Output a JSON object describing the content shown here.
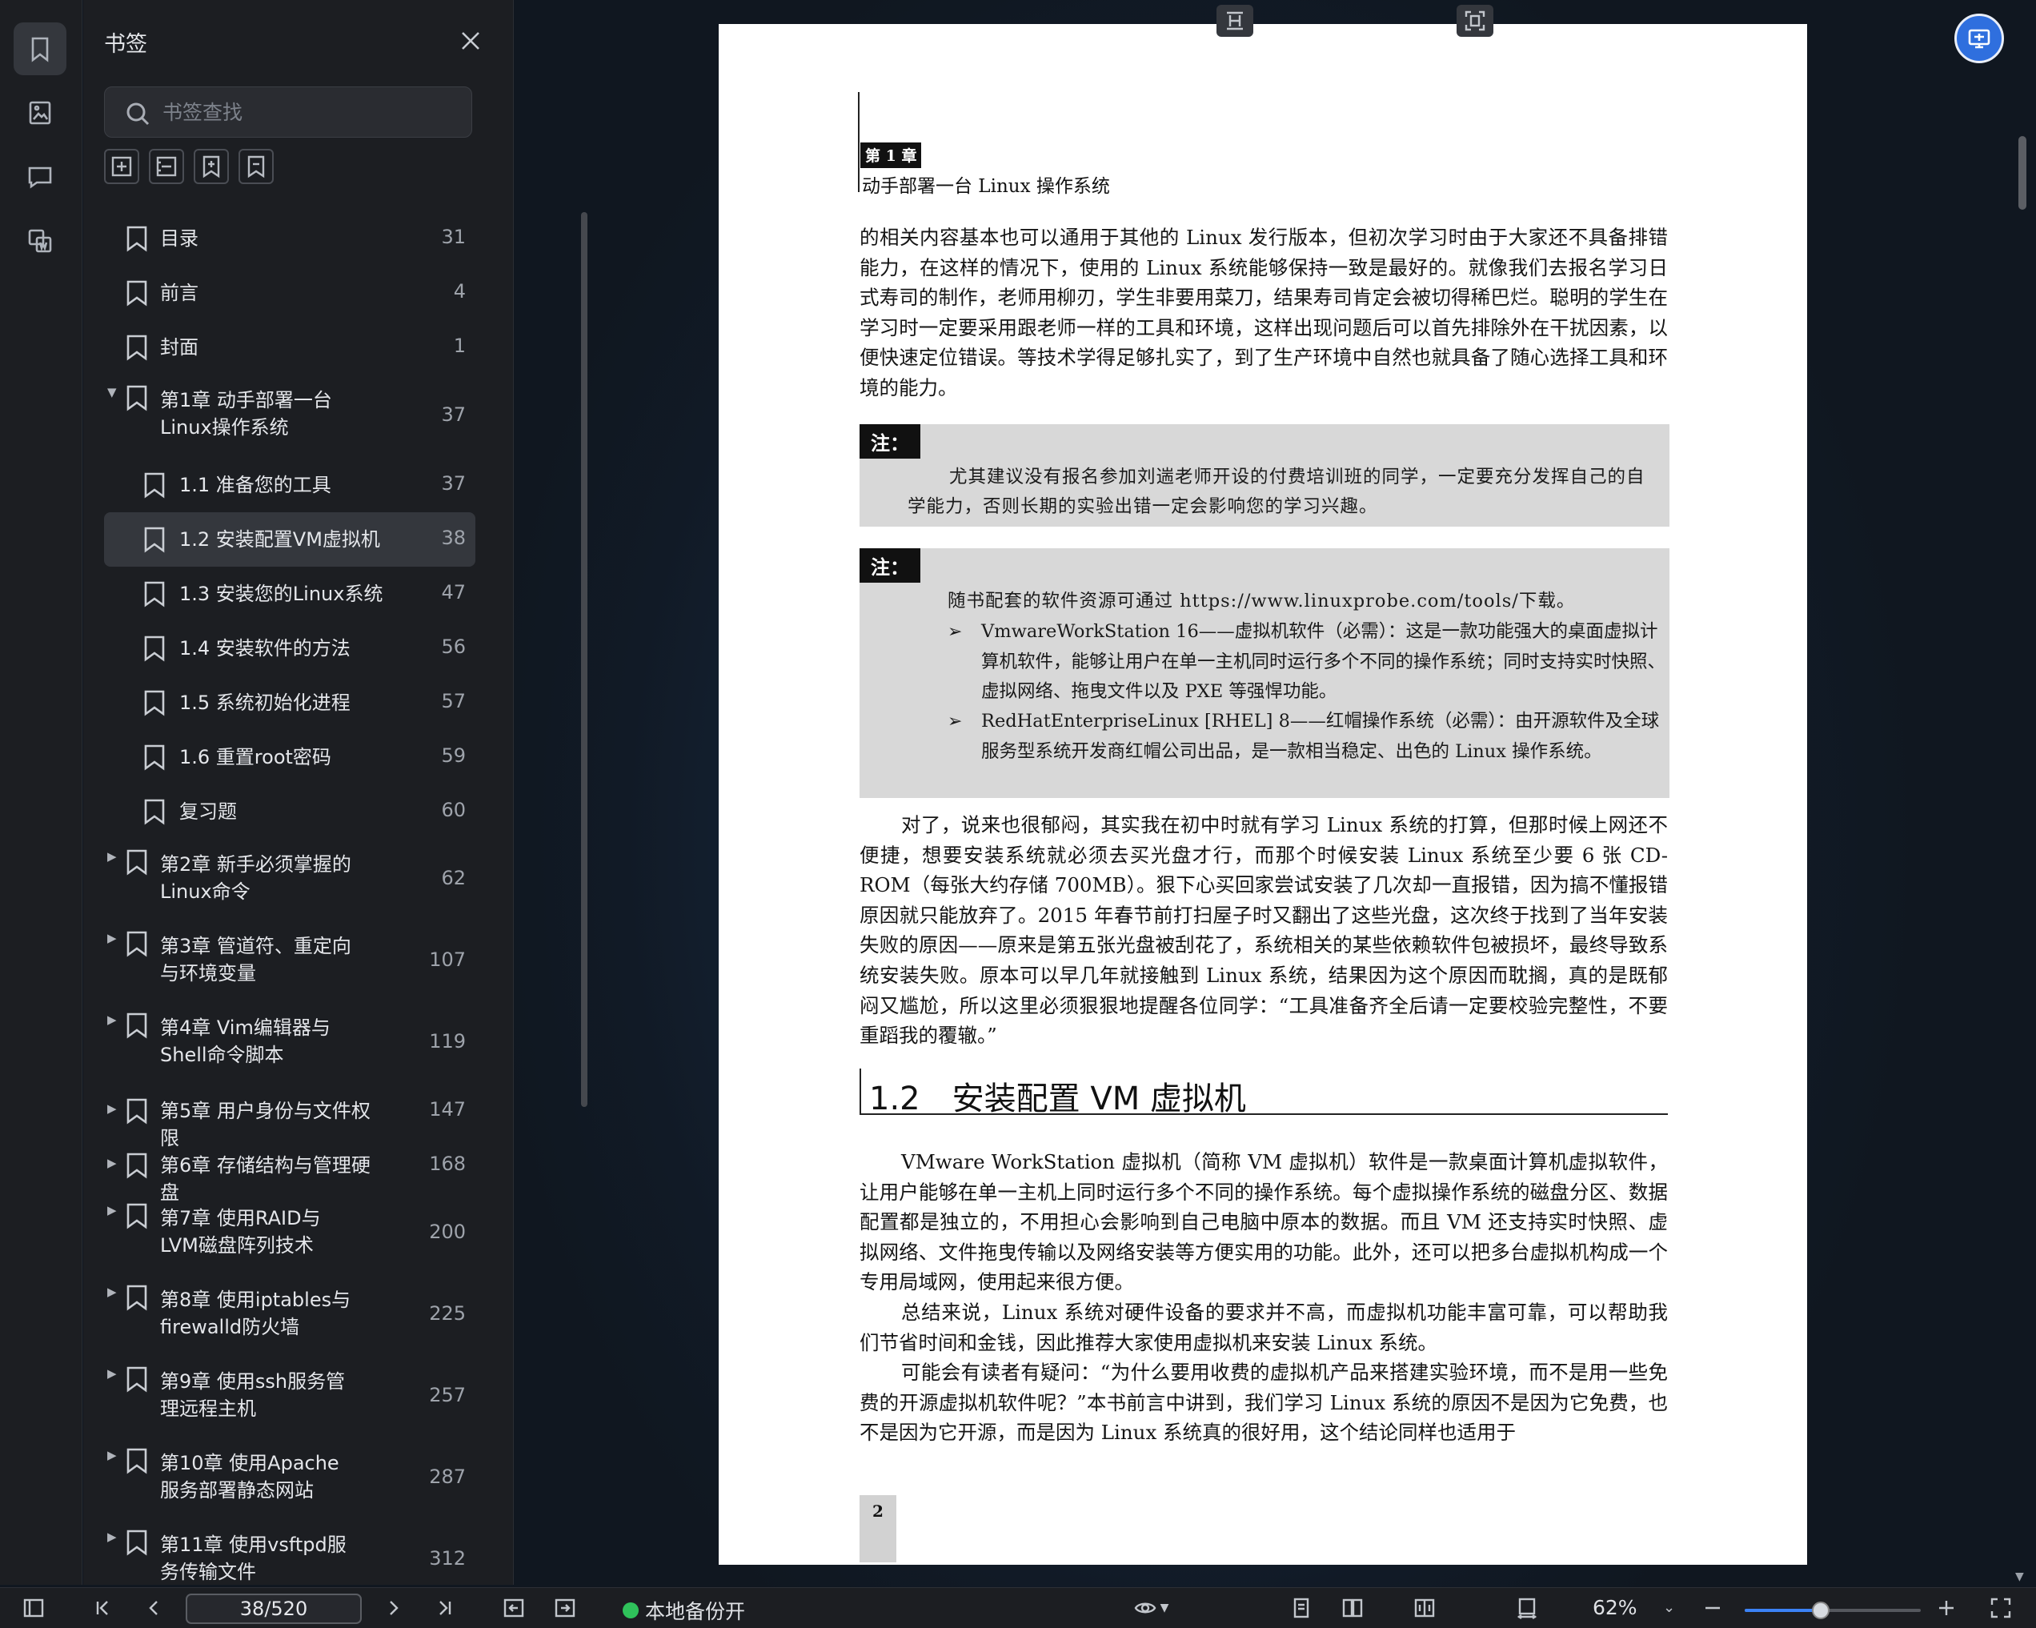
{
  "panel": {
    "title": "书签",
    "search_placeholder": "书签查找"
  },
  "bookmarks": [
    {
      "label": "目录",
      "page": "31"
    },
    {
      "label": "前言",
      "page": "4"
    },
    {
      "label": "封面",
      "page": "1"
    },
    {
      "label": "第1章 动手部署一台Linux操作系统",
      "page": "37",
      "expanded": true
    },
    {
      "label": "1.1 准备您的工具",
      "page": "37"
    },
    {
      "label": "1.2 安装配置VM虚拟机",
      "page": "38",
      "selected": true
    },
    {
      "label": "1.3 安装您的Linux系统",
      "page": "47"
    },
    {
      "label": "1.4 安装软件的方法",
      "page": "56"
    },
    {
      "label": "1.5 系统初始化进程",
      "page": "57"
    },
    {
      "label": "1.6 重置root密码",
      "page": "59"
    },
    {
      "label": "复习题",
      "page": "60"
    },
    {
      "label": "第2章 新手必须掌握的Linux命令",
      "page": "62"
    },
    {
      "label": "第3章 管道符、重定向与环境变量",
      "page": "107"
    },
    {
      "label": "第4章 Vim编辑器与Shell命令脚本",
      "page": "119"
    },
    {
      "label": "第5章 用户身份与文件权限",
      "page": "147"
    },
    {
      "label": "第6章 存储结构与管理硬盘",
      "page": "168"
    },
    {
      "label": "第7章 使用RAID与LVM磁盘阵列技术",
      "page": "200"
    },
    {
      "label": "第8章 使用iptables与firewalld防火墙",
      "page": "225"
    },
    {
      "label": "第9章 使用ssh服务管理远程主机",
      "page": "257"
    },
    {
      "label": "第10章 使用Apache服务部署静态网站",
      "page": "287"
    },
    {
      "label": "第11章 使用vsftpd服务传输文件",
      "page": "312"
    }
  ],
  "document": {
    "chapter_tag": "第 1 章",
    "running_head": "动手部署一台 Linux 操作系统",
    "p1": "的相关内容基本也可以通用于其他的 Linux 发行版本，但初次学习时由于大家还不具备排错能力，在这样的情况下，使用的 Linux 系统能够保持一致是最好的。就像我们去报名学习日式寿司的制作，老师用柳刃，学生非要用菜刀，结果寿司肯定会被切得稀巴烂。聪明的学生在学习时一定要采用跟老师一样的工具和环境，这样出现问题后可以首先排除外在干扰因素，以便快速定位错误。等技术学得足够扎实了，到了生产环境中自然也就具备了随心选择工具和环境的能力。",
    "note_label": "注：",
    "note1": "尤其建议没有报名参加刘遄老师开设的付费培训班的同学，一定要充分发挥自己的自学能力，否则长期的实验出错一定会影响您的学习兴趣。",
    "note2_intro": "随书配套的软件资源可通过 https://www.linuxprobe.com/tools/下载。",
    "bullet_mark": "➢",
    "bullet1": "VmwareWorkStation 16——虚拟机软件（必需）：这是一款功能强大的桌面虚拟计算机软件，能够让用户在单一主机同时运行多个不同的操作系统；同时支持实时快照、虚拟网络、拖曳文件以及 PXE 等强悍功能。",
    "bullet2": "RedHatEnterpriseLinux [RHEL] 8——红帽操作系统（必需）：由开源软件及全球服务型系统开发商红帽公司出品，是一款相当稳定、出色的 Linux 操作系统。",
    "p2": "对了，说来也很郁闷，其实我在初中时就有学习 Linux 系统的打算，但那时候上网还不便捷，想要安装系统就必须去买光盘才行，而那个时候安装 Linux 系统至少要 6 张 CD-ROM（每张大约存储 700MB）。狠下心买回家尝试安装了几次却一直报错，因为搞不懂报错原因就只能放弃了。2015 年春节前打扫屋子时又翻出了这些光盘，这次终于找到了当年安装失败的原因——原来是第五张光盘被刮花了，系统相关的某些依赖软件包被损坏，最终导致系统安装失败。原本可以早几年就接触到 Linux 系统，结果因为这个原因而耽搁，真的是既郁闷又尴尬，所以这里必须狠狠地提醒各位同学：“工具准备齐全后请一定要校验完整性，不要重蹈我的覆辙。”",
    "section_title": "1.2　安装配置 VM 虚拟机",
    "p3": "VMware WorkStation 虚拟机（简称 VM 虚拟机）软件是一款桌面计算机虚拟软件，让用户能够在单一主机上同时运行多个不同的操作系统。每个虚拟操作系统的磁盘分区、数据配置都是独立的，不用担心会影响到自己电脑中原本的数据。而且 VM 还支持实时快照、虚拟网络、文件拖曳传输以及网络安装等方便实用的功能。此外，还可以把多台虚拟机构成一个专用局域网，使用起来很方便。",
    "p4": "总结来说，Linux 系统对硬件设备的要求并不高，而虚拟机功能丰富可靠，可以帮助我们节省时间和金钱，因此推荐大家使用虚拟机来安装 Linux 系统。",
    "p5": "可能会有读者有疑问：“为什么要用收费的虚拟机产品来搭建实验环境，而不是用一些免费的开源虚拟机软件呢？”本书前言中讲到，我们学习 Linux 系统的原因不是因为它免费，也不是因为它开源，而是因为 Linux 系统真的很好用，这个结论同样也适用于",
    "page_number": "2"
  },
  "bottom": {
    "page_indicator": "38/520",
    "backup_label": "本地备份开",
    "zoom": "62%",
    "zoom_fraction": 0.43
  },
  "colors": {
    "accent": "#3b82f6",
    "float_button": "#2f6fde",
    "backup_dot": "#2fc25b"
  }
}
